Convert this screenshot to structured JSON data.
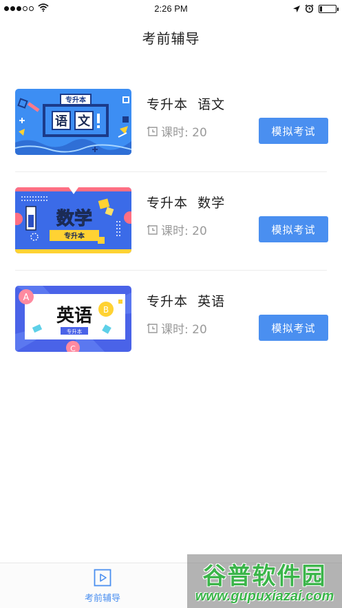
{
  "status_bar": {
    "time": "2:26 PM",
    "signal_bars_filled": 3,
    "signal_bars_total": 5,
    "battery_level": 0.15
  },
  "nav": {
    "title": "考前辅导"
  },
  "courses": [
    {
      "title": "专升本  语文",
      "hours_label": "课时: 20",
      "button_label": "模拟考试",
      "thumb_tag": "专升本",
      "thumb_text": [
        "语",
        "文"
      ],
      "thumb_bg": "#3d8ef3"
    },
    {
      "title": "专升本  数学",
      "hours_label": "课时: 20",
      "button_label": "模拟考试",
      "thumb_tag": "专升本",
      "thumb_text": [
        "数学"
      ],
      "thumb_bg": "#3b6be8"
    },
    {
      "title": "专升本  英语",
      "hours_label": "课时: 20",
      "button_label": "模拟考试",
      "thumb_tag": "专升本",
      "thumb_text": [
        "英语"
      ],
      "thumb_letters": [
        "A",
        "B",
        "C"
      ],
      "thumb_bg": "#4a63e8"
    }
  ],
  "tab_bar": {
    "tabs": [
      {
        "label": "考前辅导",
        "active": true,
        "icon": "play-icon"
      }
    ]
  },
  "watermark": {
    "main": "谷普软件园",
    "url": "www.gupuxiazai.com"
  },
  "colors": {
    "accent": "#4a8ff0",
    "muted_text": "#9a9a9a"
  }
}
